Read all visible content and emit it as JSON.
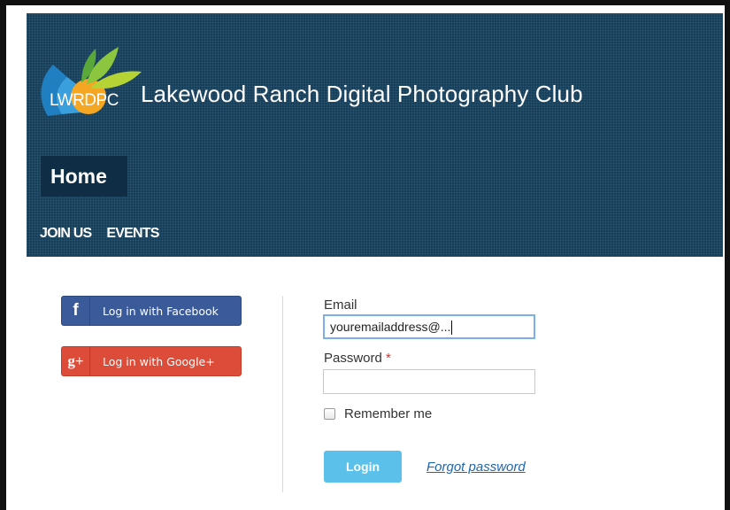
{
  "header": {
    "logo_text": "LWRDPC",
    "site_title": "Lakewood Ranch Digital Photography Club",
    "home_label": "Home",
    "nav": [
      {
        "label": "JOIN US"
      },
      {
        "label": "EVENTS"
      }
    ]
  },
  "social": {
    "facebook": {
      "icon": "f",
      "label": "Log in with Facebook",
      "color": "#3b5a99"
    },
    "google": {
      "icon": "g+",
      "label": "Log in with Google+",
      "color": "#dd4b39"
    }
  },
  "form": {
    "email_label": "Email",
    "email_value": "youremailaddress@...",
    "password_label": "Password",
    "required_marker": "*",
    "password_value": "",
    "remember_label": "Remember me",
    "remember_checked": false,
    "login_label": "Login",
    "forgot_label": "Forgot password"
  },
  "colors": {
    "header_bg": "#163f5c",
    "home_bg": "#0f2e45",
    "login_btn": "#5bc0ea",
    "link": "#1f66b0"
  }
}
